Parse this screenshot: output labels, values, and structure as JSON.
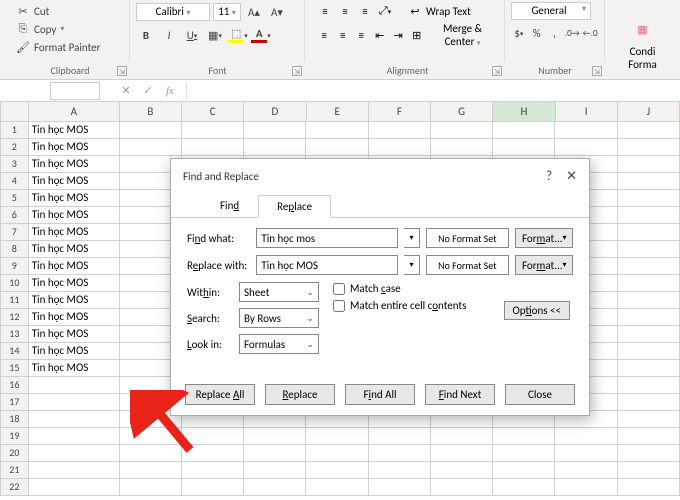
{
  "ribbon": {
    "clipboard": {
      "cut": "Cut",
      "copy": "Copy",
      "paint": "Format Painter",
      "label": "Clipboard"
    },
    "font": {
      "name": "Calibri",
      "size": "11",
      "label": "Font"
    },
    "alignment": {
      "wrap": "Wrap Text",
      "merge": "Merge & Center",
      "label": "Alignment"
    },
    "number": {
      "format": "General",
      "label": "Number",
      "dollar": "$",
      "pct": "%",
      "comma": ","
    },
    "cond": {
      "label": "Condi",
      "fmt": "Forma"
    }
  },
  "columns": [
    "A",
    "B",
    "C",
    "D",
    "E",
    "F",
    "G",
    "H",
    "I",
    "J"
  ],
  "cells_a": [
    "Tin học MOS",
    "Tin học MOS",
    "Tin học MOS",
    "Tin học MOS",
    "Tin học MOS",
    "Tin học MOS",
    "Tin học MOS",
    "Tin học MOS",
    "Tin học MOS",
    "Tin học MOS",
    "Tin học MOS",
    "Tin học MOS",
    "Tin học MOS",
    "Tin học MOS",
    "Tin học MOS"
  ],
  "dialog": {
    "title": "Find and Replace",
    "tabs": {
      "find": "Find",
      "replace": "Replace"
    },
    "find_label": "Find what:",
    "find_value": "Tin học mos",
    "replace_label": "Replace with:",
    "replace_value": "Tin học MOS",
    "no_format": "No Format Set",
    "format_btn": "Format...",
    "within_label": "Within:",
    "within_val": "Sheet",
    "search_label": "Search:",
    "search_val": "By Rows",
    "lookin_label": "Look in:",
    "lookin_val": "Formulas",
    "match_case": "Match case",
    "match_entire": "Match entire cell contents",
    "options": "Options <<",
    "btns": {
      "replace_all": "Replace All",
      "replace": "Replace",
      "find_all": "Find All",
      "find_next": "Find Next",
      "close": "Close"
    }
  }
}
